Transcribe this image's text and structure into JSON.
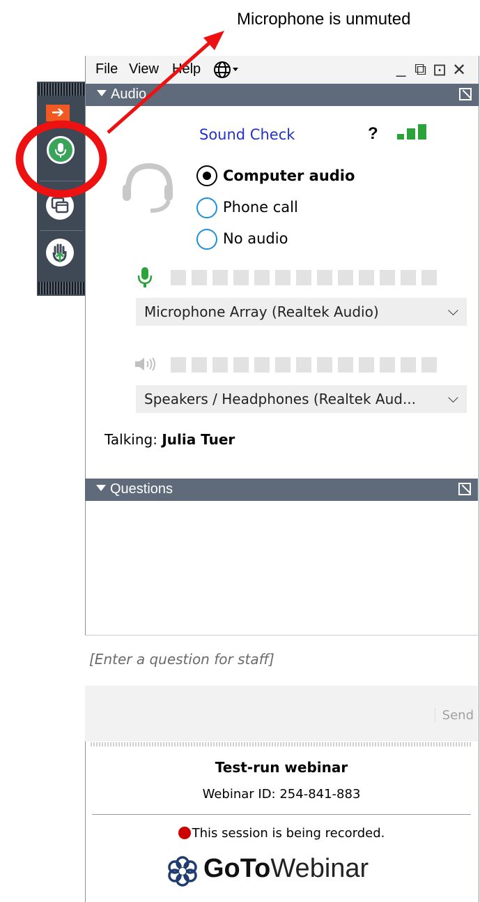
{
  "annotation": {
    "callout_text": "Microphone is unmuted",
    "highlight_color": "#ee1111"
  },
  "menu": {
    "file": "File",
    "view": "View",
    "help": "Help",
    "minimize": "_",
    "popout": "⧉",
    "restore": "⊡",
    "close": "✕"
  },
  "audio": {
    "header": "Audio",
    "sound_check": "Sound Check",
    "help": "?",
    "options": [
      {
        "label": "Computer audio",
        "selected": true
      },
      {
        "label": "Phone call",
        "selected": false
      },
      {
        "label": "No audio",
        "selected": false
      }
    ],
    "microphone_device": "Microphone Array (Realtek Audio)",
    "speaker_device": "Speakers / Headphones (Realtek Aud...",
    "talking_label": "Talking:",
    "talking_name": "Julia Tuer"
  },
  "questions": {
    "header": "Questions",
    "input_placeholder": "[Enter a question for staff]",
    "send_label": "Send"
  },
  "footer": {
    "webinar_title": "Test-run webinar",
    "webinar_id": "Webinar ID: 254-841-883",
    "recording_notice": "This session is being recorded.",
    "brand_bold": "GoTo",
    "brand_light": "Webinar"
  },
  "colors": {
    "accent_green": "#3aa35a",
    "header_bg": "#5f6b7b",
    "link_blue": "#2233cc",
    "orange": "#f05a22"
  }
}
